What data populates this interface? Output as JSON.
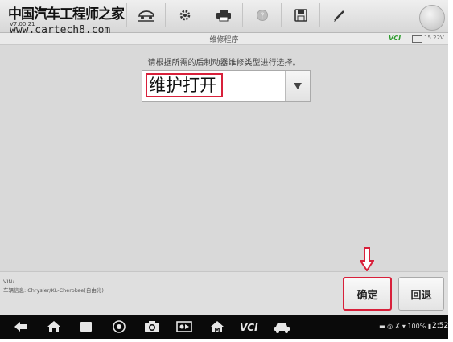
{
  "watermark": {
    "site_name": "中国汽车工程师之家",
    "url": "www.cartech8.com"
  },
  "app": {
    "version": "V7.00.21"
  },
  "toolbar": {
    "icons": [
      "home-icon",
      "vehicle-lift-icon",
      "gear-icon",
      "print-icon",
      "help-icon",
      "save-icon",
      "pen-icon",
      "circle-button"
    ]
  },
  "header": {
    "title": "维修程序",
    "vci_label": "VCI",
    "voltage": "15.22V"
  },
  "main": {
    "instruction": "请根据所需的后制动器维修类型进行选择。",
    "select": {
      "value": "维护打开"
    }
  },
  "info": {
    "vin_label": "VIN:",
    "vehicle_info": "车辆信息: Chrysler/KL-Cherokee(自由光)"
  },
  "buttons": {
    "ok_label": "确定",
    "back_label": "回退"
  },
  "navbar": {
    "icons": [
      "back-icon",
      "home-icon",
      "recent-apps-icon",
      "chrome-icon",
      "camera-icon",
      "screen-record-icon",
      "maxisys-home-icon",
      "vci-icon",
      "car-icon"
    ],
    "vci_text": "VCI",
    "status_text": "100%",
    "time": "2:52"
  },
  "colors": {
    "highlight": "#d8203a",
    "toolbar_bg": "#e2e2e2",
    "nav_bg": "#0a0a0a"
  }
}
